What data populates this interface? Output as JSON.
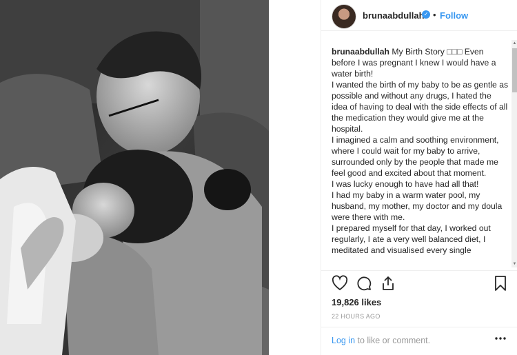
{
  "post": {
    "photo_alt": "",
    "header": {
      "username": "brunaabdullah",
      "separator": "•",
      "follow_label": "Follow",
      "verified_icon": "verified-badge-icon",
      "verified_glyph": "✓"
    },
    "caption": {
      "username": "brunaabdullah",
      "lines": [
        " My Birth Story □□□ Even before I was pregnant I knew I would have a water birth!",
        "I wanted the birth of my baby to be as gentle as possible and without any drugs, I hated the idea of having to deal with the side effects of all the medication they would give me at the hospital.",
        "I imagined a calm and soothing environment, where I could wait for my baby to arrive, surrounded only by the people that made me feel good and excited about that moment.",
        "I was lucky enough to have had all that!",
        "I had my baby in a warm water pool, my husband, my mother, my doctor and my doula were there with me.",
        "I prepared myself for that day, I worked out regularly, I ate a very well balanced diet, I meditated and visualised every single"
      ]
    },
    "actions": {
      "like_icon": "heart-icon",
      "comment_icon": "comment-icon",
      "share_icon": "share-icon",
      "save_icon": "bookmark-icon"
    },
    "likes": "19,826 likes",
    "timestamp": "22 HOURS AGO",
    "comment_prompt": {
      "login_label": "Log in",
      "rest": " to like or comment."
    },
    "more_icon": "more-options-icon"
  },
  "colors": {
    "accent": "#3897f0",
    "text": "#262626",
    "muted": "#999999",
    "border": "#efefef"
  }
}
